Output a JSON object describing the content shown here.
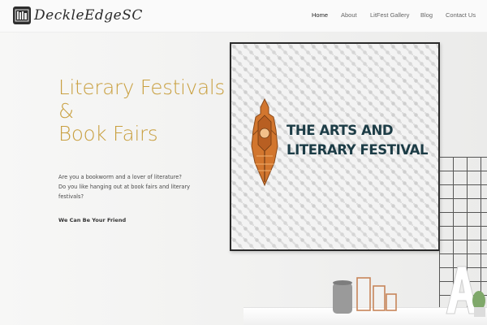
{
  "brand": {
    "name": "DeckleEdgeSC",
    "logo_icon": "book-shelf-icon"
  },
  "nav": {
    "items": [
      {
        "label": "Home",
        "active": true
      },
      {
        "label": "About",
        "active": false
      },
      {
        "label": "LitFest Gallery",
        "active": false
      },
      {
        "label": "Blog",
        "active": false
      },
      {
        "label": "Contact Us",
        "active": false
      }
    ]
  },
  "hero": {
    "title_lines": [
      "Literary Festivals",
      "&",
      "Book Fairs"
    ],
    "description_lines": [
      "Are you a bookworm and a lover of literature?",
      "Do you like hanging out at book fairs and literary",
      "festivals?"
    ],
    "cta": "We Can Be Your Friend"
  },
  "poster": {
    "title_lines": [
      "THE ARTS AND",
      "LITERARY FESTIVAL"
    ],
    "emblem_icon": "fountain-pen-nib-icon"
  },
  "colors": {
    "accent_gold": "#c9a040",
    "poster_title": "#1c3c46",
    "emblem_orange": "#d2762e",
    "logo_dark": "#2e2e2e"
  },
  "decor": {
    "letter_block": "A"
  }
}
